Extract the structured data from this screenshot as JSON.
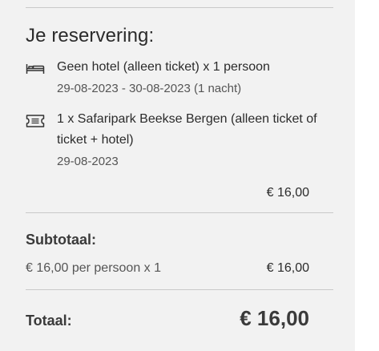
{
  "reservation": {
    "title": "Je reservering:",
    "items": [
      {
        "icon": "bed-icon",
        "main": "Geen hotel (alleen ticket) x 1 persoon",
        "sub": "29-08-2023 - 30-08-2023 (1 nacht)"
      },
      {
        "icon": "ticket-icon",
        "main": "1 x Safaripark Beekse Bergen (alleen ticket of ticket + hotel)",
        "sub": "29-08-2023"
      }
    ],
    "item_price": "€ 16,00"
  },
  "subtotal": {
    "label": "Subtotaal:",
    "description": "€ 16,00 per persoon x 1",
    "amount": "€ 16,00"
  },
  "total": {
    "label": "Totaal:",
    "amount": "€ 16,00"
  }
}
